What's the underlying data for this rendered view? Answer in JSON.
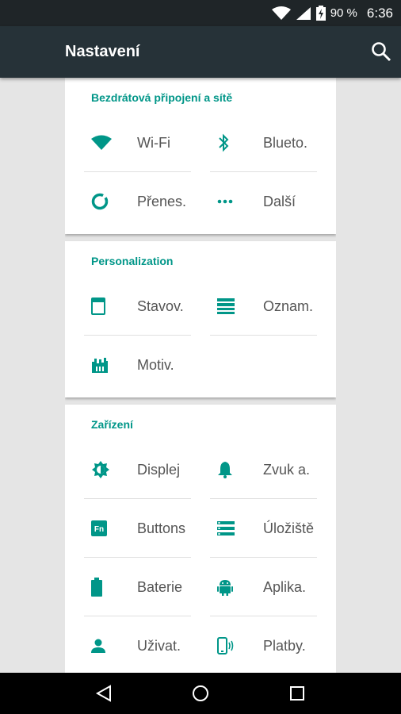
{
  "status_bar": {
    "battery": "90 %",
    "time": "6:36"
  },
  "toolbar": {
    "title": "Nastavení",
    "search_icon": "search-icon"
  },
  "accent": "#009688",
  "sections": [
    {
      "title": "Bezdrátová připojení a sítě",
      "items": [
        {
          "label": "Wi-Fi",
          "icon": "wifi-icon"
        },
        {
          "label": "Blueto.",
          "icon": "bluetooth-icon"
        },
        {
          "label": "Přenes.",
          "icon": "data-usage-icon"
        },
        {
          "label": "Další",
          "icon": "more-icon"
        }
      ]
    },
    {
      "title": "Personalization",
      "items": [
        {
          "label": "Stavov.",
          "icon": "status-bar-icon"
        },
        {
          "label": "Oznam.",
          "icon": "notifications-icon"
        },
        {
          "label": "Motiv.",
          "icon": "theme-icon"
        }
      ]
    },
    {
      "title": "Zařízení",
      "items": [
        {
          "label": "Displej",
          "icon": "brightness-icon"
        },
        {
          "label": "Zvuk a.",
          "icon": "bell-icon"
        },
        {
          "label": "Buttons",
          "icon": "fn-icon"
        },
        {
          "label": "Úložiště",
          "icon": "storage-icon"
        },
        {
          "label": "Baterie",
          "icon": "battery-icon"
        },
        {
          "label": "Aplika.",
          "icon": "android-icon"
        },
        {
          "label": "Uživat.",
          "icon": "user-icon"
        },
        {
          "label": "Platby.",
          "icon": "tap-pay-icon"
        }
      ]
    }
  ],
  "nav_bar": {
    "back": "back-icon",
    "home": "home-icon",
    "recents": "recents-icon"
  }
}
